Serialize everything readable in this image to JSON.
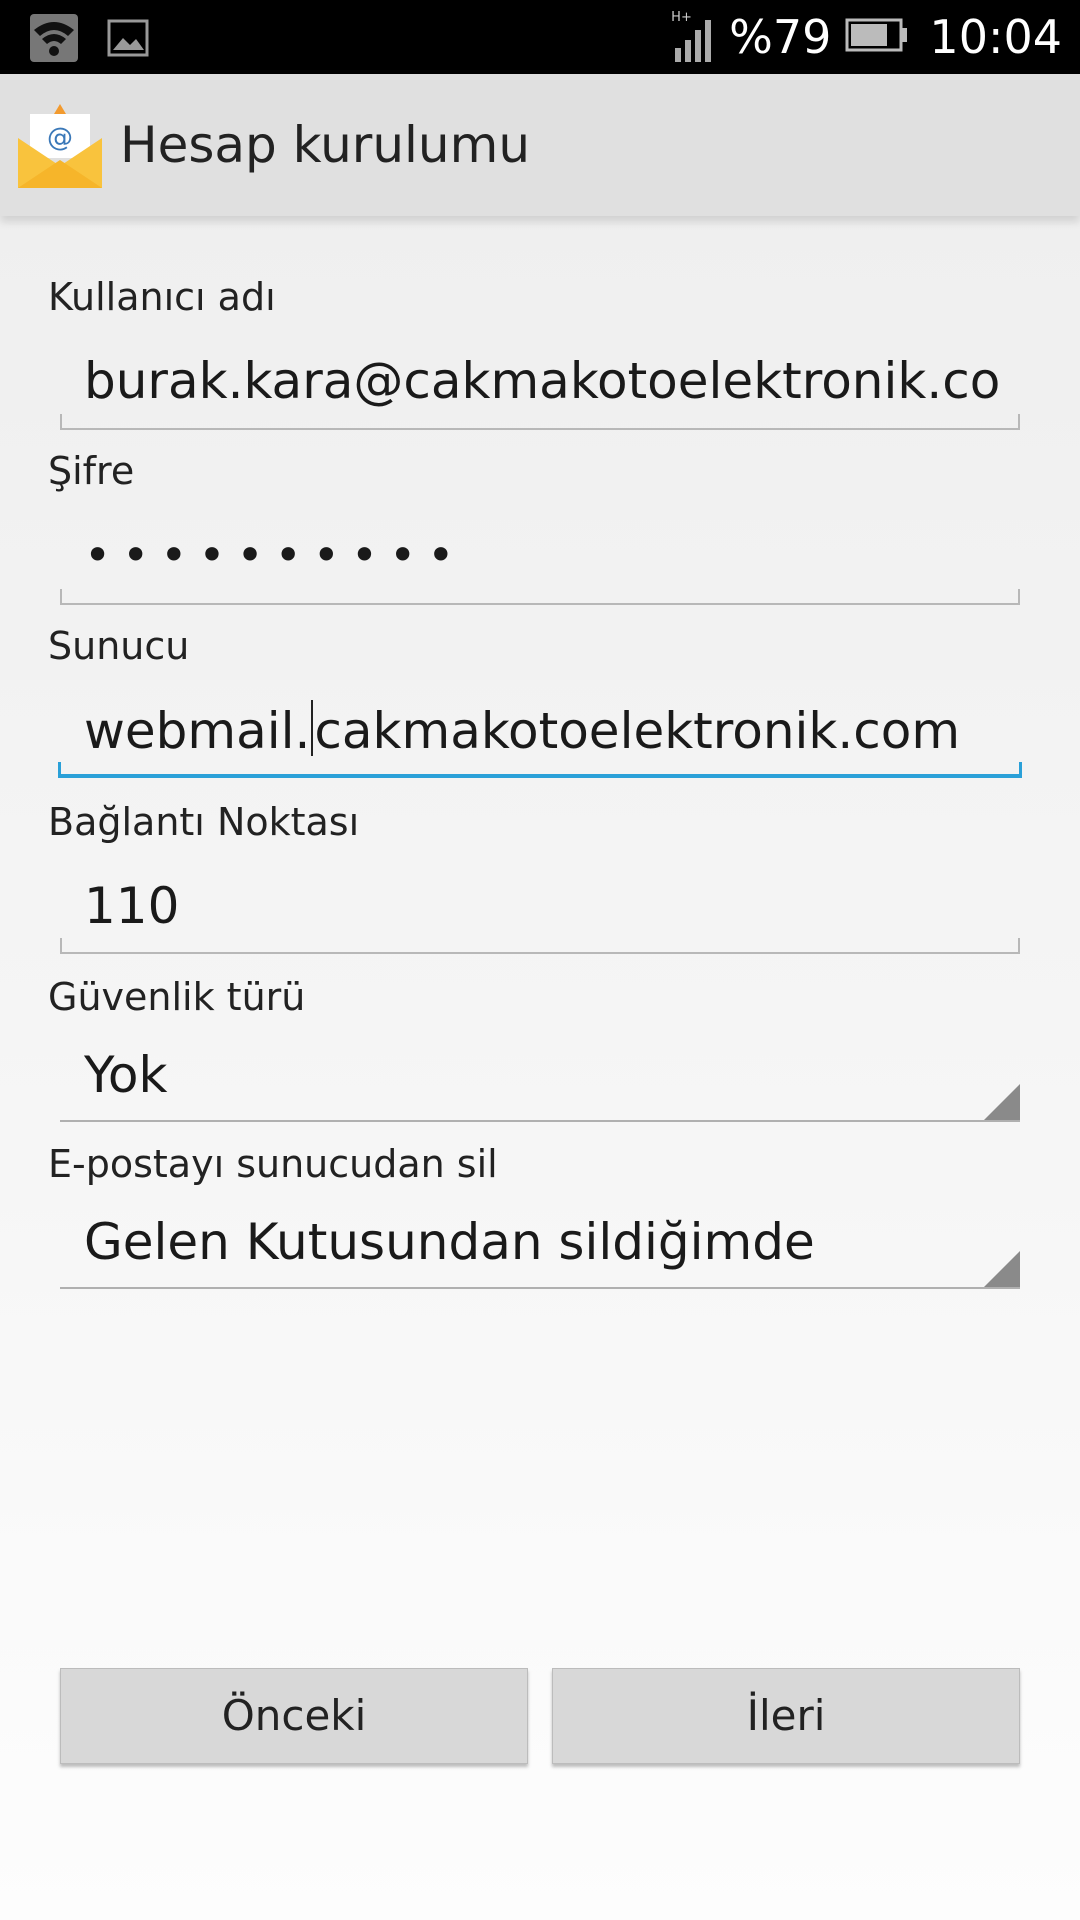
{
  "status_bar": {
    "network_type": "H+",
    "battery_percent": "%79",
    "battery_level": 0.79,
    "time": "10:04",
    "icons": [
      "wifi-icon",
      "image-icon",
      "signal-icon",
      "battery-icon"
    ]
  },
  "action_bar": {
    "title": "Hesap kurulumu",
    "icon": "email-icon"
  },
  "form": {
    "username_label": "Kullanıcı adı",
    "username_value": "burak.kara@cakmakotoelektronik.com",
    "password_label": "Şifre",
    "password_value": "••••••••••",
    "server_label": "Sunucu",
    "server_value_before_cursor": "webmail.",
    "server_value_after_cursor": "cakmakotoelektronik.com",
    "port_label": "Bağlantı Noktası",
    "port_value": "110",
    "security_label": "Güvenlik türü",
    "security_value": "Yok",
    "delete_label": "E-postayı sunucudan sil",
    "delete_value": "Gelen Kutusundan sildiğimde"
  },
  "buttons": {
    "previous": "Önceki",
    "next": "İleri"
  },
  "colors": {
    "focus_accent": "#2aa0d8",
    "envelope": "#f9c33d",
    "envelope_flap": "#f29a2e"
  }
}
